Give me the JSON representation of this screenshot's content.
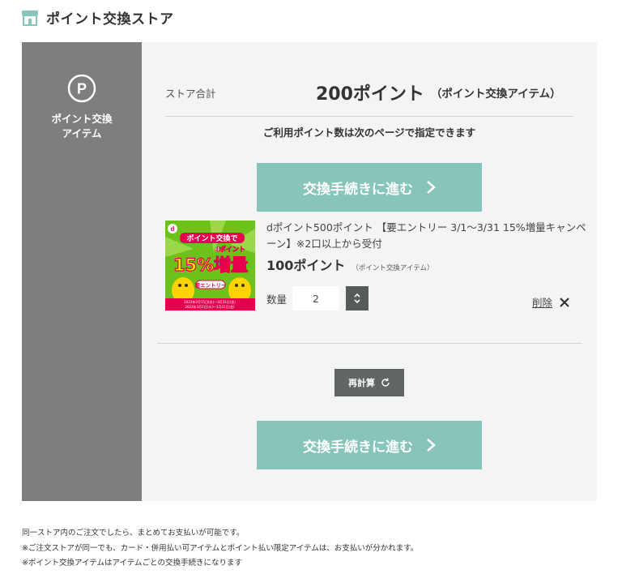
{
  "header": {
    "title": "ポイント交換ストア",
    "icon": "store-icon"
  },
  "sidebar": {
    "icon": "p-circle-icon",
    "icon_letter": "P",
    "label_line1": "ポイント交換",
    "label_line2": "アイテム"
  },
  "summary": {
    "label": "ストア合計",
    "total": "200ポイント",
    "total_type": "（ポイント交換アイテム）",
    "note": "ご利用ポイント数は次のページで指定できます"
  },
  "next_button_label": "交換手続きに進む",
  "item": {
    "title": "dポイント500ポイント 【要エントリー 3/1～3/31 15%増量キャンペーン】※2口以上から受付",
    "price": "100ポイント",
    "price_type": "（ポイント交換アイテム）",
    "image": {
      "headline": "ポイント交換で",
      "big_text": "15%増量",
      "sub_text": "dポイント",
      "entry_label": "要エントリー",
      "period1": "2023年2月15日(水)～3月31日(金)",
      "period2": "2023年3月1日(水)～3月31日(金)"
    },
    "qty_label": "数量",
    "qty_value": "2",
    "delete_label": "削除"
  },
  "recalc_label": "再計算",
  "footer": {
    "line1": "同一ストア内のご注文でしたら、まとめてお支払いが可能です。",
    "line2": "※ご注文ストアが同一でも、カード・併用払い可アイテムとポイント払い限定アイテムは、お支払いが分かれます。",
    "line3": "※ポイント交換アイテムはアイテムごとの交換手続きになります"
  },
  "colors": {
    "accent": "#87c5bb",
    "sidebar": "#7d7f7d",
    "panel": "#f3f4f4",
    "dark_button": "#616565"
  }
}
